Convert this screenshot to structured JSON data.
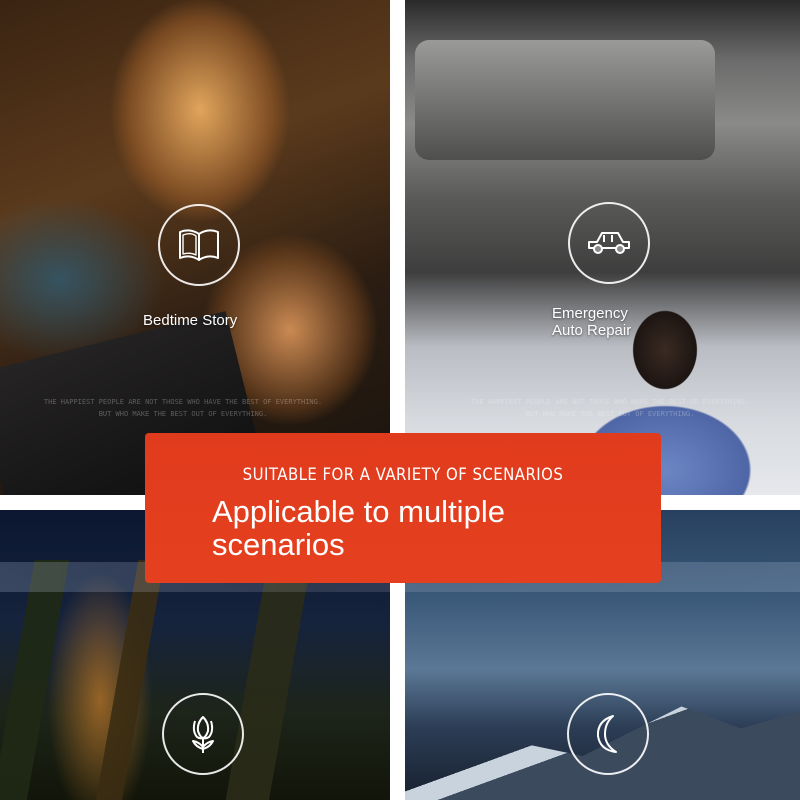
{
  "panels": {
    "top_left": {
      "label": "Bedtime Story",
      "icon": "open-book-icon"
    },
    "top_right": {
      "label_line1": "Emergency",
      "label_line2": "Auto Repair",
      "icon": "car-icon"
    },
    "bottom_left": {
      "icon": "tulip-icon"
    },
    "bottom_right": {
      "icon": "crescent-moon-icon"
    }
  },
  "fine_print": {
    "line1": "THE HAPPIEST PEOPLE ARE NOT THOSE WHO HAVE THE BEST OF EVERYTHING.",
    "line2": "BUT WHO MAKE THE BEST OUT OF EVERYTHING."
  },
  "banner": {
    "subtitle": "SUITABLE FOR A VARIETY OF SCENARIOS",
    "title_line1": "Applicable to multiple",
    "title_line2": "scenarios",
    "color": "#e23a1c"
  }
}
